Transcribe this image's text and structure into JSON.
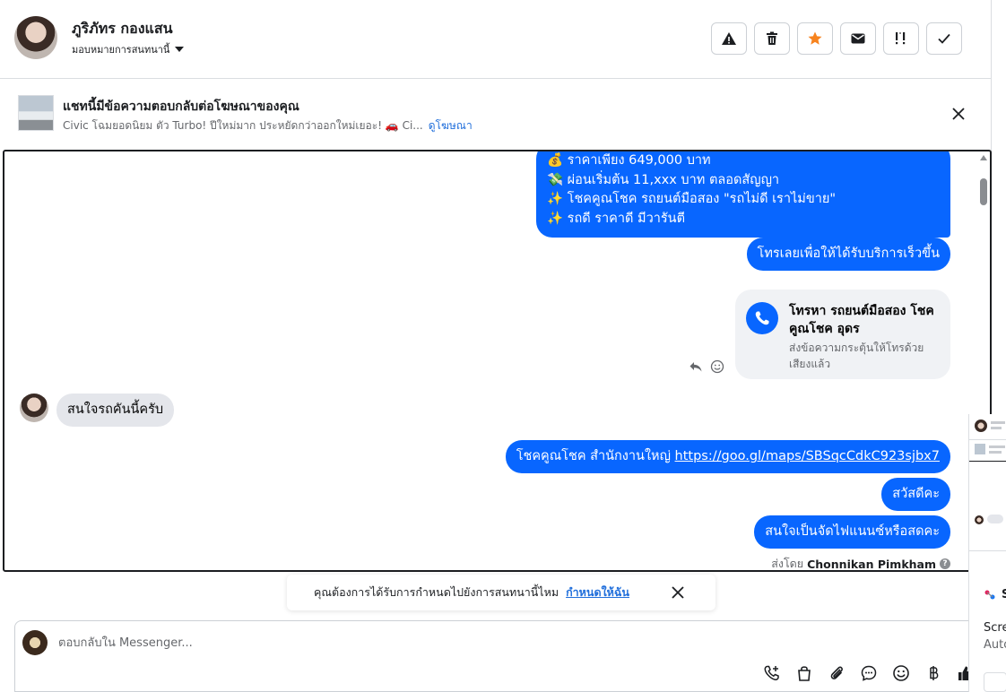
{
  "header": {
    "contact_name": "ภูริภัทร กองแสน",
    "assign_label": "มอบหมายการสนทนานี้"
  },
  "ad_banner": {
    "title": "แชทนี้มีข้อความตอบกลับต่อโฆษณาของคุณ",
    "subtitle": "Civic โฉมยอดนิยม ตัว Turbo! ปีใหม่มาก ประหยัดกว่าออกใหม่เยอะ! 🚗 Ci...",
    "link": "ดูโฆษณา"
  },
  "messages": {
    "promo_lines": [
      "💰 ราคาเพียง 649,000 บาท",
      "💸 ผ่อนเริ่มต้น 11,xxx บาท ตลอดสัญญา",
      "✨ โชคคูณโชค รถยนต์มือสอง \"รถไม่ดี เราไม่ขาย\"",
      "✨ รถดี ราคาดี มีวารันตี"
    ],
    "call_now": "โทรเลยเพื่อให้ได้รับบริการเร็วขึ้น",
    "call_card_title": "โทรหา รถยนต์มือสอง โชคคูณโชค อุดร",
    "call_card_sub": "ส่งข้อความกระตุ้นให้โทรด้วยเสียงแล้ว",
    "incoming": "สนใจรถคันนี้ครับ",
    "office_prefix": "โชคคูณโชค สำนักงานใหญ่ ",
    "office_link": "https://goo.gl/maps/SBSqcCdkC923sjbx7",
    "hello": "สวัสดีคะ",
    "question": "สนใจเป็นจัดไฟแนนซ์หรือสดคะ",
    "sent_by_label": "ส่งโดย",
    "sent_by_name": "Chonnikan Pimkham"
  },
  "reminder": {
    "text": "คุณต้องการได้รับการกำหนดไปยังการสนทนานี้ไหม",
    "link": "กำหนดให้ฉัน"
  },
  "composer": {
    "placeholder": "ตอบกลับใน Messenger..."
  },
  "side_fragment": {
    "title_initial": "S",
    "line1": "Scre",
    "line2": "Auto"
  },
  "colors": {
    "accent": "#0866ff",
    "link": "#216fdb",
    "star": "#f7831e"
  }
}
